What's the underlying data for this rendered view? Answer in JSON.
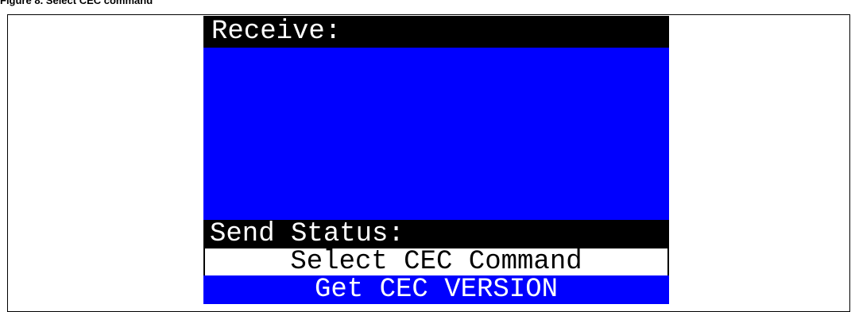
{
  "caption": {
    "text": "Figure 8. Select CEC command"
  },
  "lcd": {
    "receive_label": "Receive:",
    "receive_content": "",
    "send_status_label": "Send Status:",
    "menu_title": "Select CEC Command",
    "selected_command": "Get CEC VERSION"
  },
  "colors": {
    "header_bg": "#000000",
    "header_fg": "#ffffff",
    "receive_area_bg": "#0000ff",
    "menu_title_bg": "#ffffff",
    "menu_selected_bg": "#0000ff",
    "menu_selected_fg": "#ffffff"
  }
}
